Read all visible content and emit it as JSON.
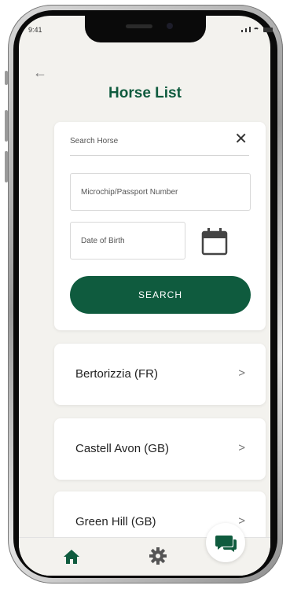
{
  "status_bar": {
    "time": "9:41"
  },
  "header": {
    "title": "Horse List",
    "back_icon": "arrow-left-icon"
  },
  "search": {
    "horse_placeholder": "Search Horse",
    "clear_icon": "close-icon",
    "microchip_placeholder": "Microchip/Passport Number",
    "dob_placeholder": "Date of Birth",
    "calendar_icon": "calendar-icon",
    "button_label": "SEARCH"
  },
  "horses": [
    {
      "name": "Bertorizzia (FR)",
      "chevron": ">"
    },
    {
      "name": "Castell Avon (GB)",
      "chevron": ">"
    },
    {
      "name": "Green Hill (GB)",
      "chevron": ">"
    }
  ],
  "tab_bar": {
    "home_icon": "home-icon",
    "settings_icon": "gear-icon",
    "chat_icon": "chat-icon"
  },
  "colors": {
    "brand_green": "#0f5b3e",
    "background": "#f3f2ee",
    "card": "#ffffff"
  }
}
